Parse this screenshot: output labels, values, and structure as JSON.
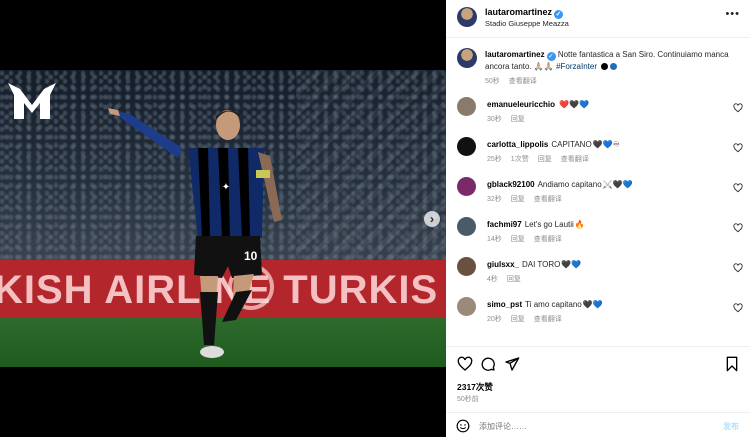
{
  "post": {
    "username": "lautaromartinez",
    "location": "Stadio Giuseppe Meazza",
    "caption_prefix": "Notte fantastica a San Siro. Continuiamo manca ancora tanto. 🙏🏼🙏🏼 ",
    "hashtag": "#ForzaInter",
    "caption_time": "50秒",
    "see_translation": "查看翻译",
    "more_icon": "more-dots-icon",
    "dot_colors": [
      "#000000",
      "#1e6fb3"
    ]
  },
  "media": {
    "banner_text": "KISH AIRLINE TURKIS",
    "jersey_number": "10",
    "next_icon": "chevron-right-icon"
  },
  "comments": [
    {
      "user": "emanueleuricchio",
      "text": "",
      "emoji": "❤️🖤💙",
      "time": "30秒",
      "reply": "回复",
      "extra": "",
      "translate": "",
      "avatar_color": "#8a7a6a"
    },
    {
      "user": "carlotta_lippolis",
      "text": "CAPITANO",
      "emoji": "🖤💙♾",
      "time": "25秒",
      "reply": "回复",
      "extra": "1次赞",
      "translate": "查看翻译",
      "avatar_color": "#111111"
    },
    {
      "user": "gblack92100",
      "text": "Andiamo capitano",
      "emoji": "⚔️🖤💙",
      "time": "32秒",
      "reply": "回复",
      "extra": "",
      "translate": "查看翻译",
      "avatar_color": "#7a2a6a"
    },
    {
      "user": "fachmi97",
      "text": "Let's go Lautii",
      "emoji": "🔥",
      "time": "14秒",
      "reply": "回复",
      "extra": "",
      "translate": "查看翻译",
      "avatar_color": "#4a5a66"
    },
    {
      "user": "giulsxx_",
      "text": "DAI TORO",
      "emoji": "🖤💙",
      "time": "4秒",
      "reply": "回复",
      "extra": "",
      "translate": "",
      "avatar_color": "#6a5040"
    },
    {
      "user": "simo_pst",
      "text": "Ti amo capitano",
      "emoji": "🖤💙",
      "time": "20秒",
      "reply": "回复",
      "extra": "",
      "translate": "查看翻译",
      "avatar_color": "#9a8a7a"
    }
  ],
  "actions": {
    "like_icon": "heart-icon",
    "comment_icon": "comment-icon",
    "share_icon": "share-icon",
    "save_icon": "bookmark-icon",
    "likes": "2317次赞",
    "when": "50秒前",
    "add_comment_placeholder": "添加评论……",
    "post_label": "发布",
    "emoji_icon": "emoji-icon"
  }
}
